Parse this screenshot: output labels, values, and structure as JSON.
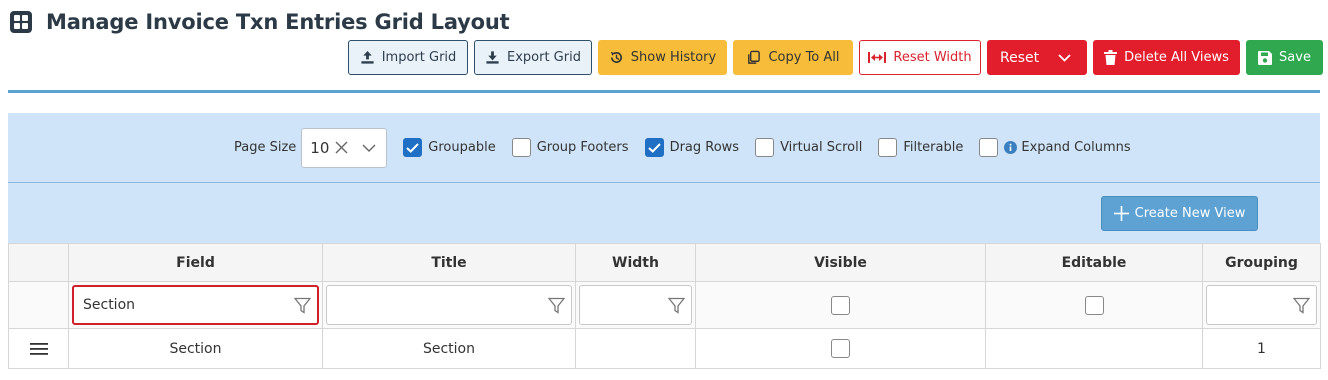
{
  "header": {
    "title": "Manage Invoice Txn Entries Grid Layout",
    "icon": "grid-icon"
  },
  "toolbar": {
    "import_label": "Import Grid",
    "export_label": "Export Grid",
    "history_label": "Show History",
    "copy_label": "Copy To All",
    "reset_width_label": "Reset Width",
    "reset_label": "Reset",
    "delete_label": "Delete All Views",
    "save_label": "Save"
  },
  "options": {
    "page_size_label": "Page Size",
    "page_size_value": "10",
    "groupable": {
      "label": "Groupable",
      "checked": true
    },
    "group_footers": {
      "label": "Group Footers",
      "checked": false
    },
    "drag_rows": {
      "label": "Drag Rows",
      "checked": true
    },
    "virtual_scroll": {
      "label": "Virtual Scroll",
      "checked": false
    },
    "filterable": {
      "label": "Filterable",
      "checked": false
    },
    "expand_columns": {
      "label": "Expand Columns",
      "checked": false
    }
  },
  "view": {
    "create_label": "Create New View"
  },
  "grid": {
    "columns": [
      "Field",
      "Title",
      "Width",
      "Visible",
      "Editable",
      "Grouping"
    ],
    "filter": {
      "field_value": "Section"
    },
    "rows": [
      {
        "field": "Section",
        "title": "Section",
        "width": "",
        "visible": false,
        "editable": "",
        "grouping": "1"
      }
    ]
  },
  "colors": {
    "accent_blue": "#1f6fc4",
    "panel_bg": "#cfe4f8",
    "danger": "#e21e2d",
    "warning": "#f7bd3a",
    "success": "#2fa84f"
  }
}
